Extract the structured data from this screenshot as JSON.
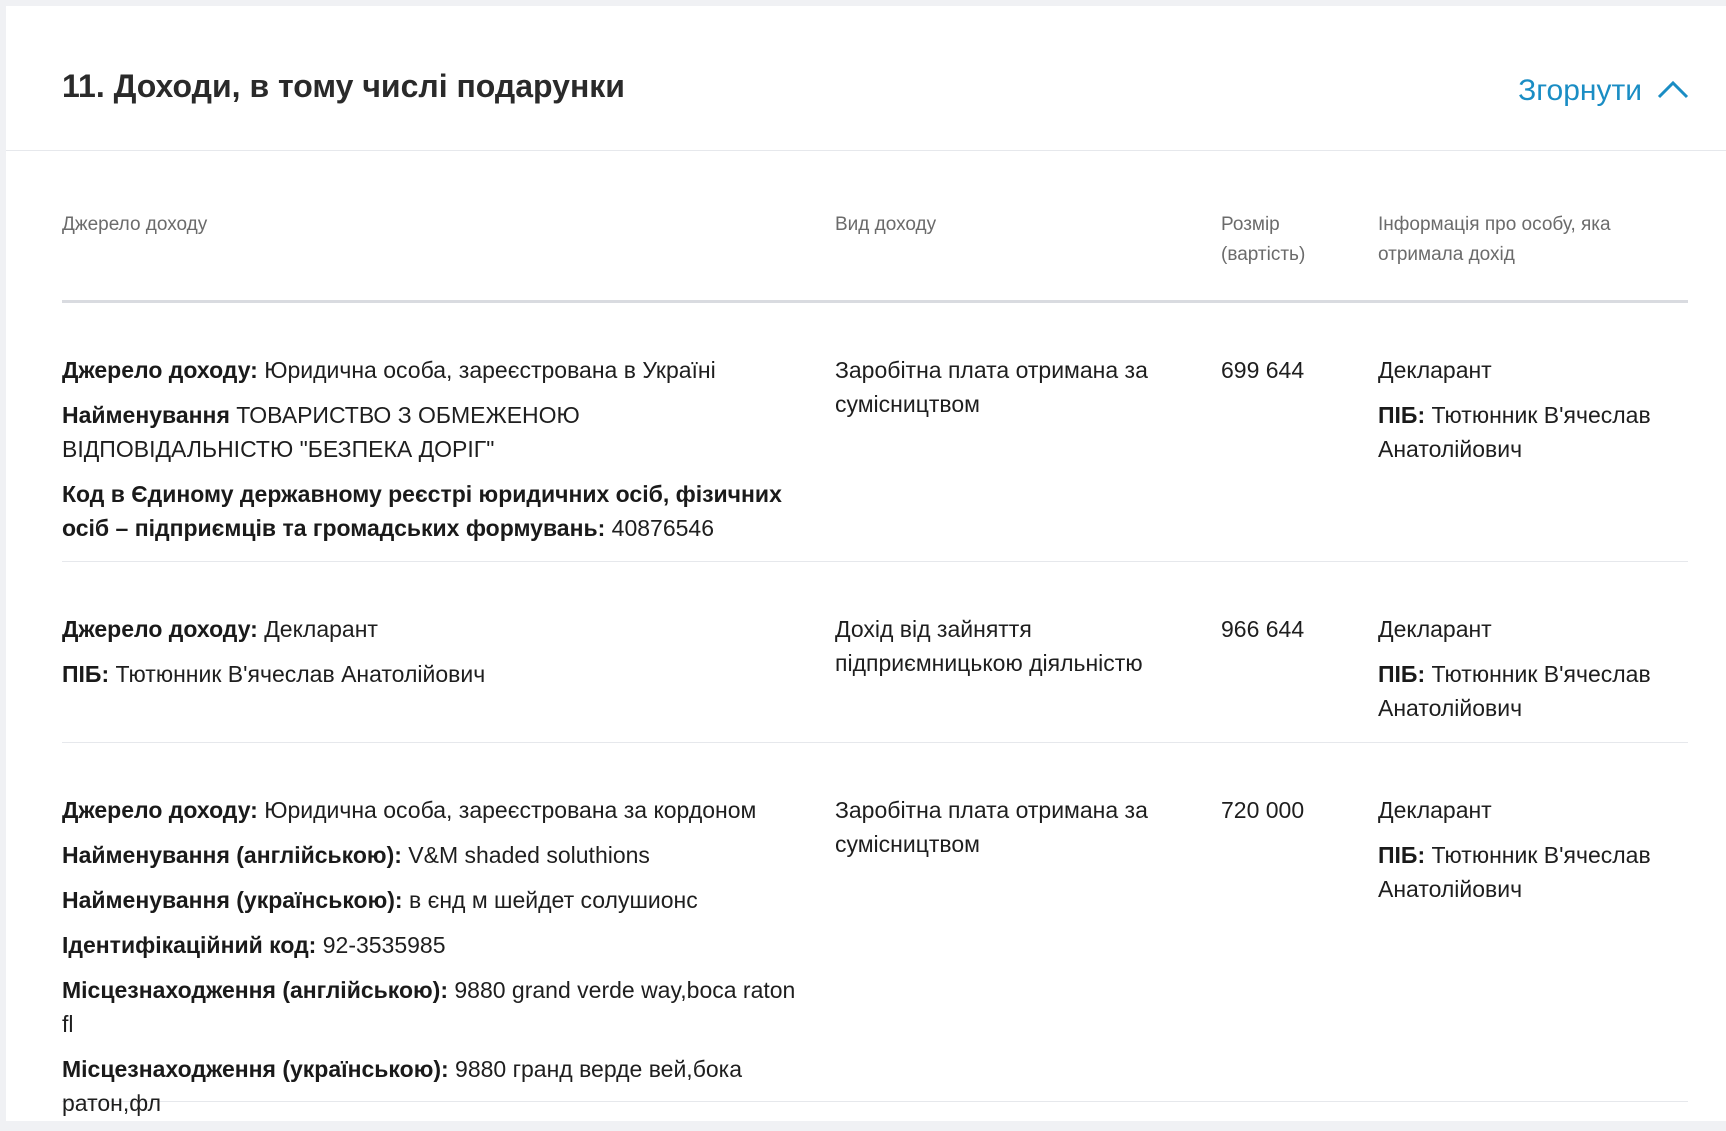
{
  "section": {
    "title": "11. Доходи, в тому числі подарунки",
    "collapse_label": "Згорнути"
  },
  "columns": [
    "Джерело доходу",
    "Вид доходу",
    "Розмір (вартість)",
    "Інформація про особу, яка отримала дохід"
  ],
  "rows": [
    {
      "source": [
        {
          "label": "Джерело доходу:",
          "value": "Юридична особа, зареєстрована в Україні"
        },
        {
          "label": "Найменування",
          "value": "ТОВАРИСТВО З ОБМЕЖЕНОЮ ВІДПОВІДАЛЬНІСТЮ \"БЕЗПЕКА ДОРІГ\""
        },
        {
          "label": "Код в Єдиному державному реєстрі юридичних осіб, фізичних осіб – підприємців та громадських формувань:",
          "value": "40876546"
        }
      ],
      "type": "Заробітна плата отримана за сумісництвом",
      "amount": "699 644",
      "recipient": "Декларант",
      "recipient_name_label": "ПІБ:",
      "recipient_name": "Тютюнник В'ячеслав Анатолійович"
    },
    {
      "source": [
        {
          "label": "Джерело доходу:",
          "value": "Декларант"
        },
        {
          "label": "ПІБ:",
          "value": "Тютюнник В'ячеслав Анатолійович"
        }
      ],
      "type": "Дохід від зайняття підприємницькою діяльністю",
      "amount": "966 644",
      "recipient": "Декларант",
      "recipient_name_label": "ПІБ:",
      "recipient_name": "Тютюнник В'ячеслав Анатолійович"
    },
    {
      "source": [
        {
          "label": "Джерело доходу:",
          "value": "Юридична особа, зареєстрована за кордоном"
        },
        {
          "label": "Найменування (англійською):",
          "value": "V&M shaded soluthions"
        },
        {
          "label": "Найменування (українською):",
          "value": "в єнд м шейдет солушионс"
        },
        {
          "label": "Ідентифікаційний код:",
          "value": "92-3535985"
        },
        {
          "label": "Місцезнаходження (англійською):",
          "value": "9880 grand verde way,boca raton fl"
        },
        {
          "label": "Місцезнаходження (українською):",
          "value": "9880 гранд верде вей,бока ратон,фл"
        }
      ],
      "type": "Заробітна плата отримана за сумісництвом",
      "amount": "720 000",
      "recipient": "Декларант",
      "recipient_name_label": "ПІБ:",
      "recipient_name": "Тютюнник В'ячеслав Анатолійович"
    }
  ],
  "colors": {
    "accent": "#1a8dc4",
    "background": "#f0f1f4",
    "card": "#ffffff"
  }
}
